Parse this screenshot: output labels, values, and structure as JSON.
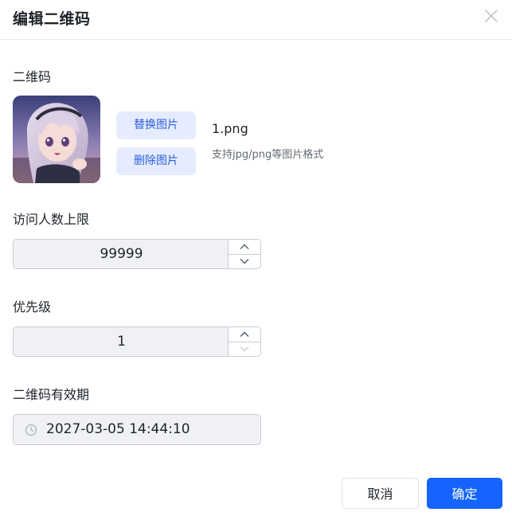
{
  "dialog": {
    "title": "编辑二维码"
  },
  "qrcode": {
    "label": "二维码",
    "replace_button": "替换图片",
    "delete_button": "删除图片",
    "file_name": "1.png",
    "file_hint": "支持jpg/png等图片格式"
  },
  "visitor_limit": {
    "label": "访问人数上限",
    "value": "99999"
  },
  "priority": {
    "label": "优先级",
    "value": "1"
  },
  "expiry": {
    "label": "二维码有效期",
    "value": "2027-03-05 14:44:10"
  },
  "footer": {
    "cancel_label": "取消",
    "confirm_label": "确定"
  },
  "colors": {
    "primary": "#1664ff",
    "secondary_button_bg": "#e6ecff",
    "secondary_button_text": "#2b5fdd",
    "input_bg": "#f0f1f4"
  },
  "icons": {
    "close": "close-icon",
    "step_up": "chevron-up-icon",
    "step_down": "chevron-down-icon",
    "clock": "clock-icon"
  }
}
